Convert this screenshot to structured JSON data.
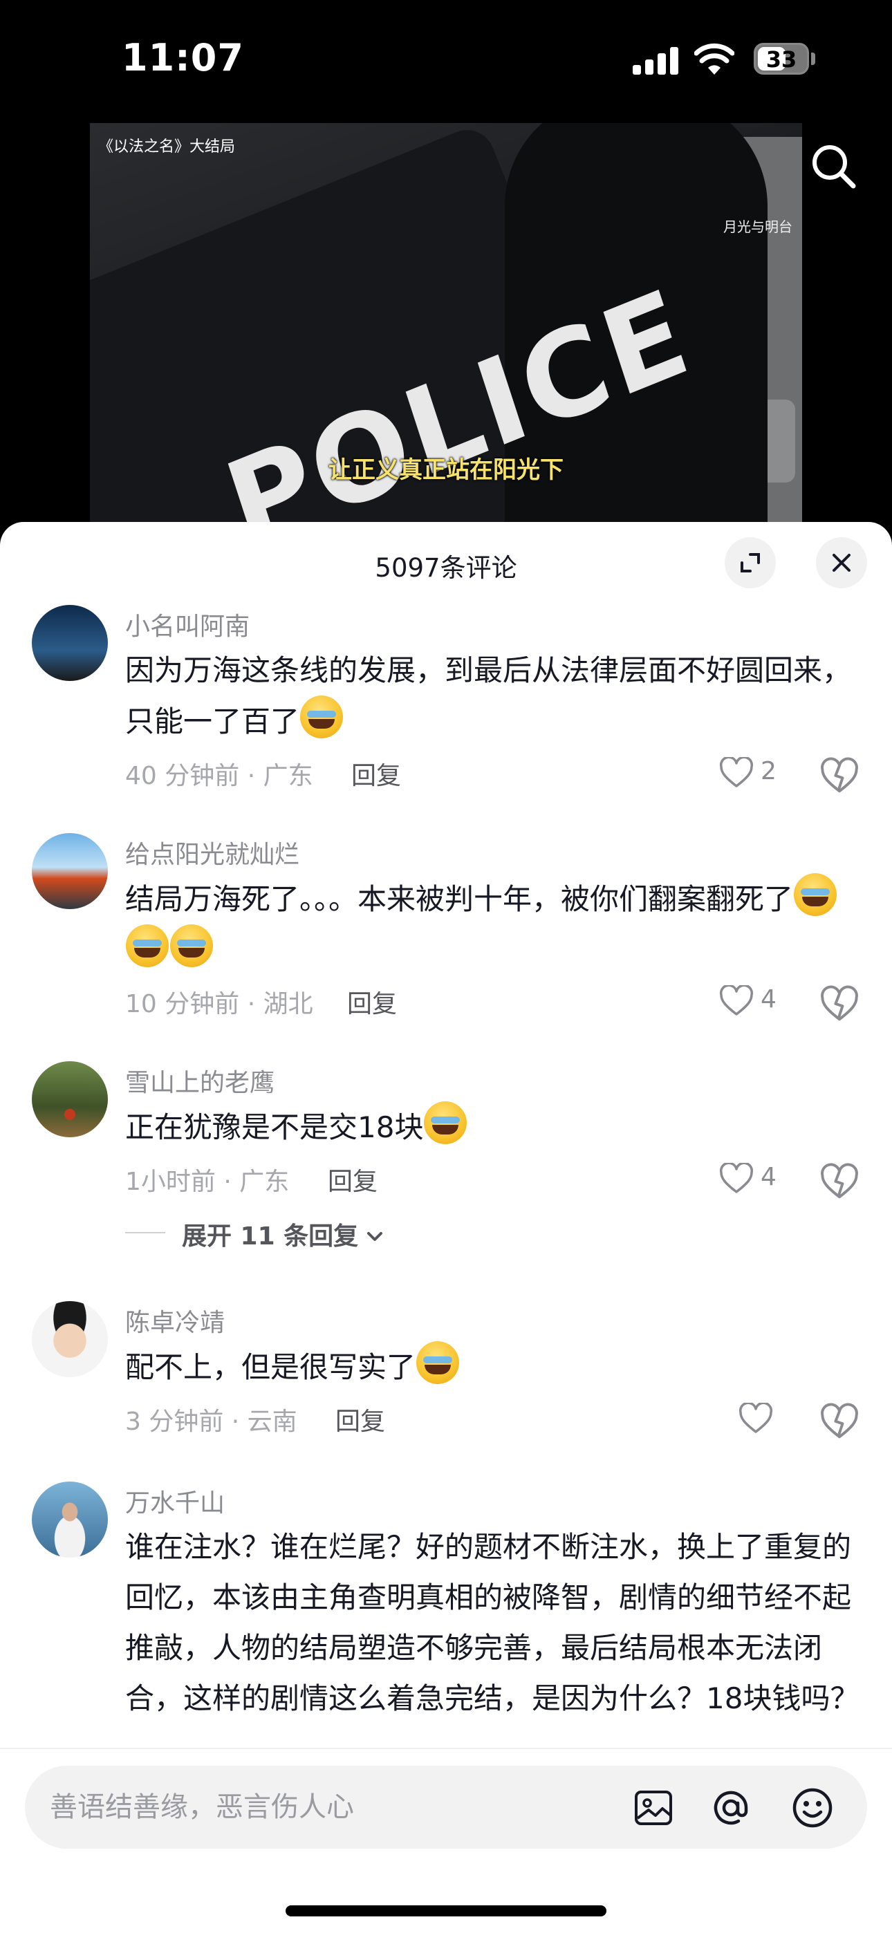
{
  "status_bar": {
    "time": "11:07",
    "battery": "33"
  },
  "video": {
    "title": "《以法之名》大结局",
    "watermark": "月光与明台",
    "subtitle": "让正义真正站在阳光下",
    "police_text": "POLICE"
  },
  "comments_header": {
    "title": "5097条评论"
  },
  "comments": [
    {
      "user": "小名叫阿南",
      "text": "因为万海这条线的发展，到最后从法律层面不好圆回来，只能一了百了",
      "emoji_count": 1,
      "meta": "40 分钟前 · 广东",
      "reply": "回复",
      "likes": "2"
    },
    {
      "user": "给点阳光就灿烂",
      "text": "结局万海死了。。。本来被判十年，被你们翻案翻死了",
      "emoji_count": 3,
      "meta": "10 分钟前 · 湖北",
      "reply": "回复",
      "likes": "4"
    },
    {
      "user": "雪山上的老鹰",
      "text": "正在犹豫是不是交18块",
      "emoji_count": 1,
      "meta": "1小时前 · 广东",
      "reply": "回复",
      "likes": "4",
      "expand": "展开 11 条回复"
    },
    {
      "user": "陈卓冷靖",
      "text": "配不上，但是很写实了",
      "emoji_count": 1,
      "meta": "3 分钟前 · 云南",
      "reply": "回复",
      "likes": ""
    },
    {
      "user": "万水千山",
      "text": "谁在注水？谁在烂尾？好的题材不断注水，换上了重复的回忆，本该由主角查明真相的被降智，剧情的细节经不起推敲，人物的结局塑造不够完善，最后结局根本无法闭合，这样的剧情这么着急完结，是因为什么？18块钱吗？",
      "emoji_count": 0
    }
  ],
  "input": {
    "placeholder": "善语结善缘，恶言伤人心"
  },
  "icons": [
    "search-icon",
    "expand-icon",
    "close-icon",
    "heart-icon",
    "dislike-icon",
    "image-icon",
    "mention-icon",
    "emoji-icon",
    "chevron-down-icon"
  ],
  "colors": {
    "accent_text": "#161823",
    "muted_text": "#8a8b91",
    "subtitle": "#f7e36b"
  }
}
